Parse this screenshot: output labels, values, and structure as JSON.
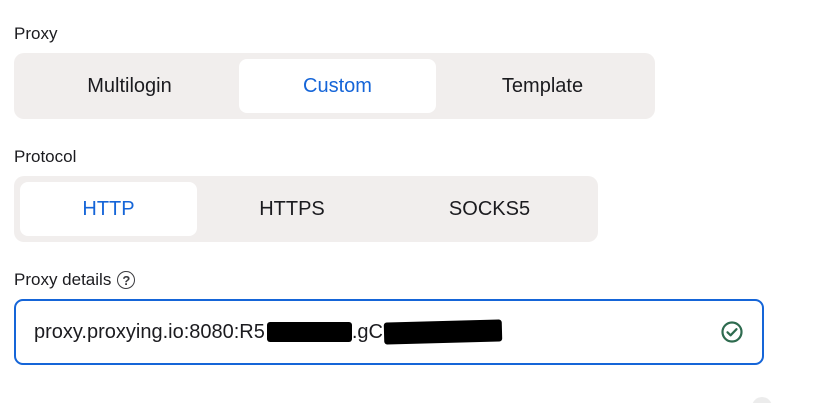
{
  "proxy": {
    "label": "Proxy",
    "options": [
      "Multilogin",
      "Custom",
      "Template"
    ],
    "selected": "Custom"
  },
  "protocol": {
    "label": "Protocol",
    "options": [
      "HTTP",
      "HTTPS",
      "SOCKS5"
    ],
    "selected": "HTTP"
  },
  "proxy_details": {
    "label": "Proxy details",
    "value_prefix": "proxy.proxying.io:8080:R5",
    "value_middle": ".gC",
    "valid_icon": "check-circle-icon"
  },
  "colors": {
    "accent": "#1565d8",
    "segment_bg": "#f1eeed",
    "valid": "#2e6b4f"
  }
}
